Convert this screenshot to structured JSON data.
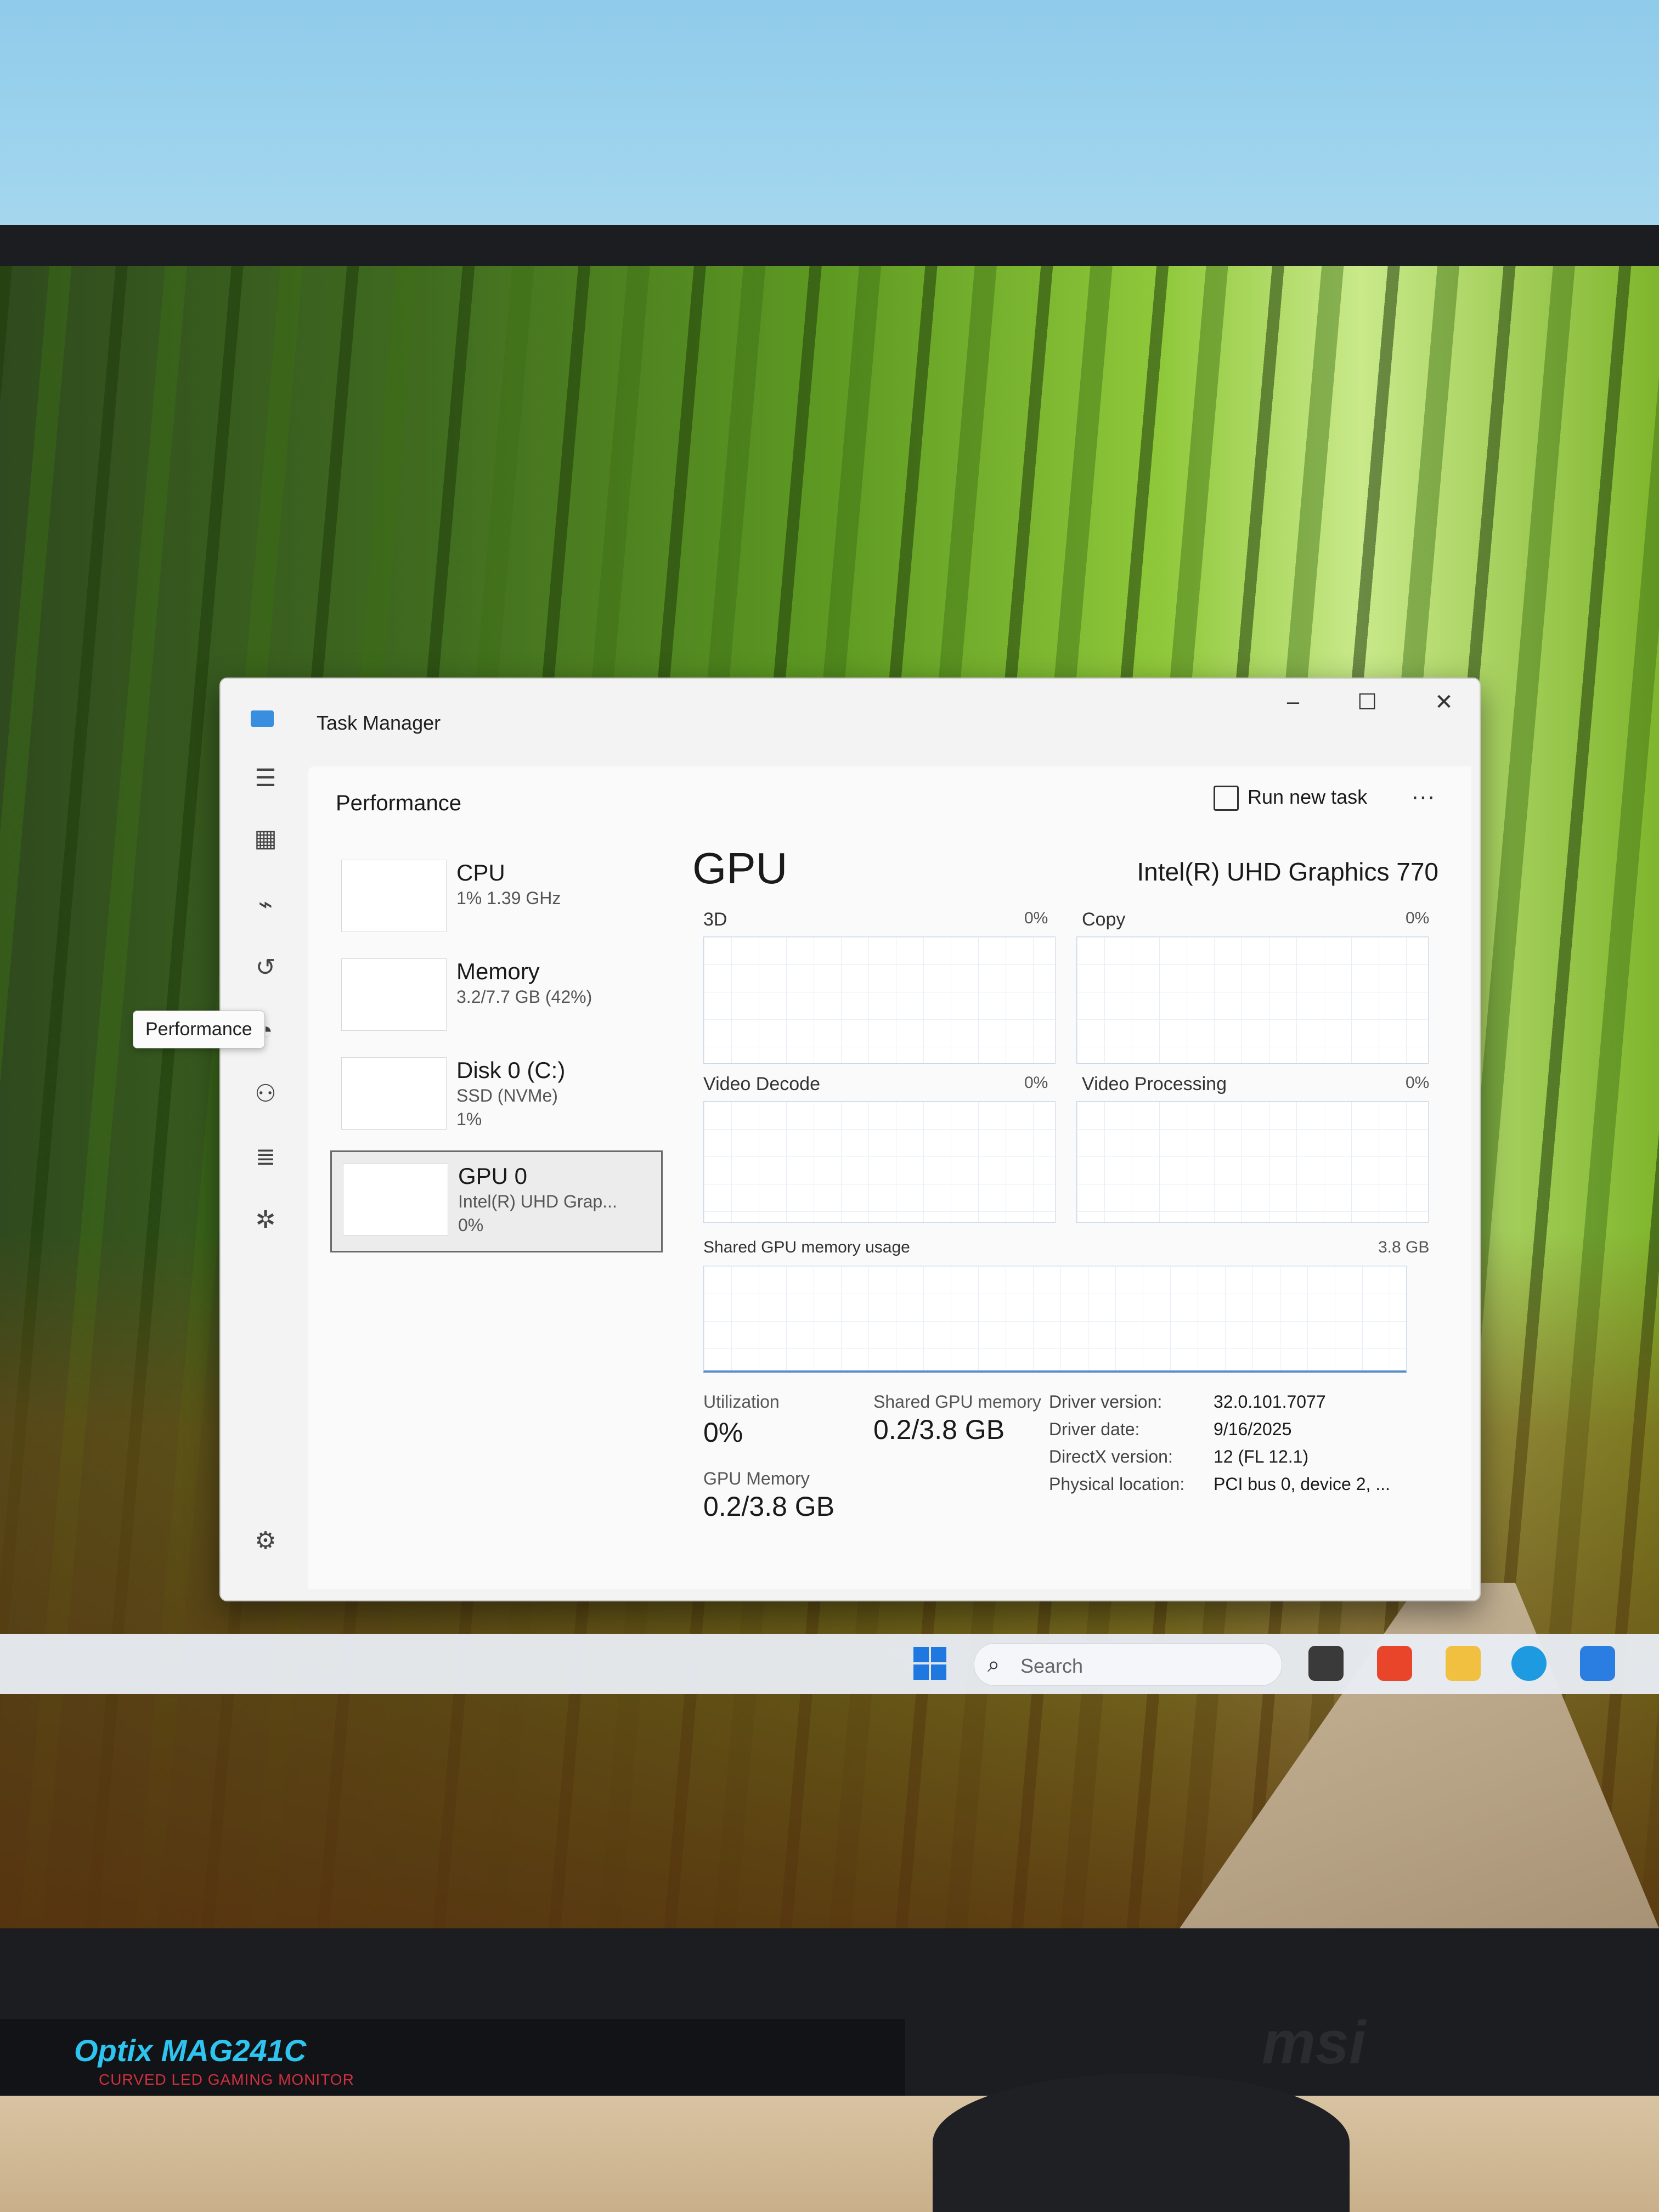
{
  "window": {
    "title": "Task Manager"
  },
  "nav": {
    "tooltip": "Performance"
  },
  "header": {
    "title": "Performance",
    "run_new_task": "Run new task",
    "more": "···"
  },
  "resources": [
    {
      "name": "CPU",
      "sub": "1% 1.39 GHz",
      "sub2": ""
    },
    {
      "name": "Memory",
      "sub": "3.2/7.7 GB (42%)",
      "sub2": ""
    },
    {
      "name": "Disk 0 (C:)",
      "sub": "SSD (NVMe)",
      "sub2": "1%"
    },
    {
      "name": "GPU 0",
      "sub": "Intel(R) UHD Grap...",
      "sub2": "0%"
    }
  ],
  "gpu": {
    "title": "GPU",
    "model": "Intel(R) UHD Graphics 770",
    "engines": [
      {
        "label": "3D",
        "pct": "0%"
      },
      {
        "label": "Copy",
        "pct": "0%"
      },
      {
        "label": "Video Decode",
        "pct": "0%"
      },
      {
        "label": "Video Processing",
        "pct": "0%"
      }
    ],
    "shared_label": "Shared GPU memory usage",
    "shared_max": "3.8 GB",
    "stats": {
      "utilization_label": "Utilization",
      "utilization": "0%",
      "shared_mem_label": "Shared GPU memory",
      "shared_mem": "0.2/3.8 GB",
      "gpu_mem_label": "GPU Memory",
      "gpu_mem": "0.2/3.8 GB"
    },
    "details": [
      {
        "k": "Driver version:",
        "v": "32.0.101.7077"
      },
      {
        "k": "Driver date:",
        "v": "9/16/2025"
      },
      {
        "k": "DirectX version:",
        "v": "12 (FL 12.1)"
      },
      {
        "k": "Physical location:",
        "v": "PCI bus 0, device 2, ..."
      }
    ]
  },
  "taskbar": {
    "search": "Search"
  },
  "monitor": {
    "model": "Optix MAG241C",
    "tagline": "CURVED LED GAMING MONITOR",
    "brand": "msi"
  },
  "colors": {
    "accent": "#1f78e0",
    "window_bg": "#f3f3f3"
  }
}
